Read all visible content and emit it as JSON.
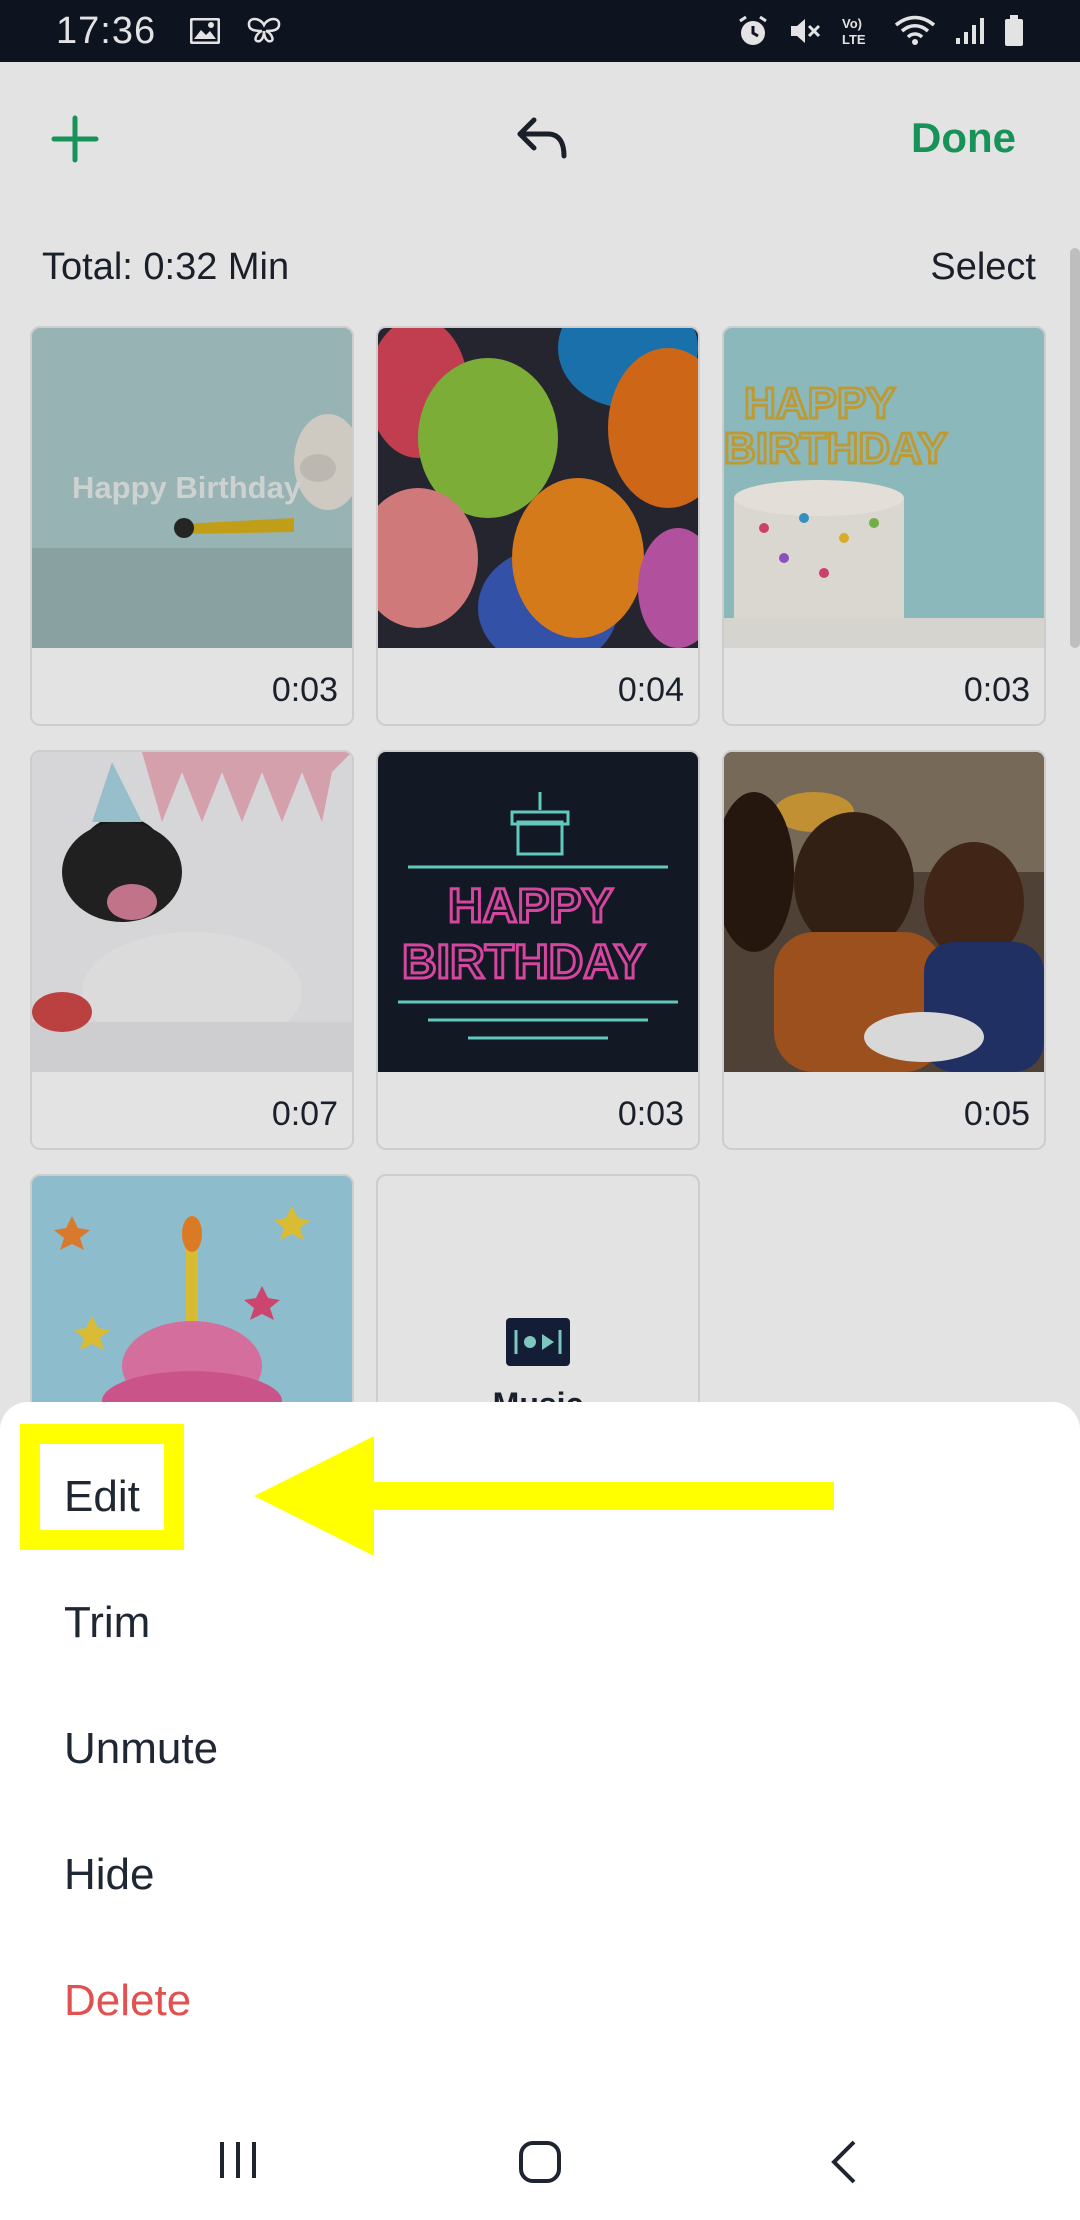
{
  "status_bar": {
    "time": "17:36",
    "icons": [
      "image-icon",
      "butterfly-icon",
      "alarm-icon",
      "mute-icon",
      "volte-icon",
      "wifi-icon",
      "signal-icon",
      "battery-icon"
    ]
  },
  "toolbar": {
    "add_icon": "plus-icon",
    "undo_icon": "undo-icon",
    "done_label": "Done"
  },
  "summary": {
    "total_label": "Total: 0:32 Min",
    "select_label": "Select"
  },
  "clips": [
    {
      "name": "happy-birthday-dog-party-horn",
      "duration": "0:03",
      "overlay_text": "Happy Birthday"
    },
    {
      "name": "balloons",
      "duration": "0:04"
    },
    {
      "name": "happy-birthday-cake",
      "duration": "0:03"
    },
    {
      "name": "bulldog-party-hat",
      "duration": "0:07"
    },
    {
      "name": "neon-happy-birthday",
      "duration": "0:03"
    },
    {
      "name": "family-birthday-cake",
      "duration": "0:05"
    },
    {
      "name": "cupcake-candle",
      "duration": ""
    },
    {
      "name": "music",
      "duration": "",
      "label": "Music"
    }
  ],
  "sheet": {
    "items": [
      {
        "label": "Edit",
        "style": "normal"
      },
      {
        "label": "Trim",
        "style": "normal"
      },
      {
        "label": "Unmute",
        "style": "normal"
      },
      {
        "label": "Hide",
        "style": "normal"
      },
      {
        "label": "Delete",
        "style": "danger"
      }
    ]
  },
  "annotation": {
    "highlight_color": "#ffff00",
    "target": "Edit"
  },
  "colors": {
    "accent": "#1aa463",
    "danger": "#e0514f",
    "status_bar": "#0f1623"
  },
  "nav_bar": {
    "recents_icon": "recents-icon",
    "home_icon": "home-icon",
    "back_icon": "back-icon"
  }
}
